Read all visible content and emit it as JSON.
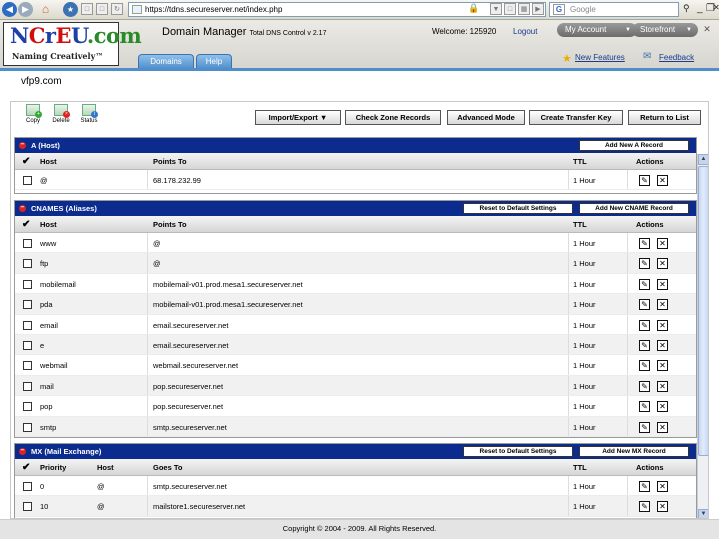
{
  "browser": {
    "url": "https://tdns.secureserver.net/index.php",
    "search_placeholder": "Google",
    "search_engine": "G"
  },
  "header": {
    "logo_text": "NCrEU.com",
    "logo_tagline": "Naming Creatively™",
    "app_title": "Domain Manager",
    "app_subtitle": "Total DNS Control v 2.17",
    "welcome": "Welcome: 125920",
    "logout": "Logout",
    "my_account": "My Account",
    "storefront": "Storefront"
  },
  "tabs": {
    "domains": "Domains",
    "help": "Help"
  },
  "links": {
    "new_features": "New Features",
    "feedback": "Feedback"
  },
  "domain_name": "vfp9.com",
  "toolbar": {
    "copy": "Copy",
    "delete": "Delete",
    "status": "Status",
    "import_export": "Import/Export",
    "check_zone": "Check Zone Records",
    "advanced": "Advanced Mode",
    "create_transfer": "Create Transfer Key",
    "return_list": "Return to List"
  },
  "a_section": {
    "title": "A (Host)",
    "add_button": "Add New A Record",
    "col_host": "Host",
    "col_points": "Points To",
    "col_ttl": "TTL",
    "col_actions": "Actions",
    "rows": [
      {
        "host": "@",
        "points": "68.178.232.99",
        "ttl": "1 Hour"
      }
    ]
  },
  "cname_section": {
    "title": "CNAMES (Aliases)",
    "reset_button": "Reset to Default Settings",
    "add_button": "Add New CNAME Record",
    "col_host": "Host",
    "col_points": "Points To",
    "col_ttl": "TTL",
    "col_actions": "Actions",
    "rows": [
      {
        "host": "www",
        "points": "@",
        "ttl": "1 Hour"
      },
      {
        "host": "ftp",
        "points": "@",
        "ttl": "1 Hour"
      },
      {
        "host": "mobilemail",
        "points": "mobilemail-v01.prod.mesa1.secureserver.net",
        "ttl": "1 Hour"
      },
      {
        "host": "pda",
        "points": "mobilemail-v01.prod.mesa1.secureserver.net",
        "ttl": "1 Hour"
      },
      {
        "host": "email",
        "points": "email.secureserver.net",
        "ttl": "1 Hour"
      },
      {
        "host": "e",
        "points": "email.secureserver.net",
        "ttl": "1 Hour"
      },
      {
        "host": "webmail",
        "points": "webmail.secureserver.net",
        "ttl": "1 Hour"
      },
      {
        "host": "mail",
        "points": "pop.secureserver.net",
        "ttl": "1 Hour"
      },
      {
        "host": "pop",
        "points": "pop.secureserver.net",
        "ttl": "1 Hour"
      },
      {
        "host": "smtp",
        "points": "smtp.secureserver.net",
        "ttl": "1 Hour"
      }
    ]
  },
  "mx_section": {
    "title": "MX (Mail Exchange)",
    "reset_button": "Reset to Default Settings",
    "add_button": "Add New MX Record",
    "col_priority": "Priority",
    "col_host": "Host",
    "col_goes": "Goes To",
    "col_ttl": "TTL",
    "col_actions": "Actions",
    "rows": [
      {
        "priority": "0",
        "host": "@",
        "goes": "smtp.secureserver.net",
        "ttl": "1 Hour"
      },
      {
        "priority": "10",
        "host": "@",
        "goes": "mailstore1.secureserver.net",
        "ttl": "1 Hour"
      }
    ]
  },
  "footer": "Copyright © 2004 - 2009. All Rights Reserved.",
  "colors": {
    "section_header": "#0b2b8f",
    "tab_blue": "#4f8dcb",
    "link": "#1a3c8c"
  }
}
